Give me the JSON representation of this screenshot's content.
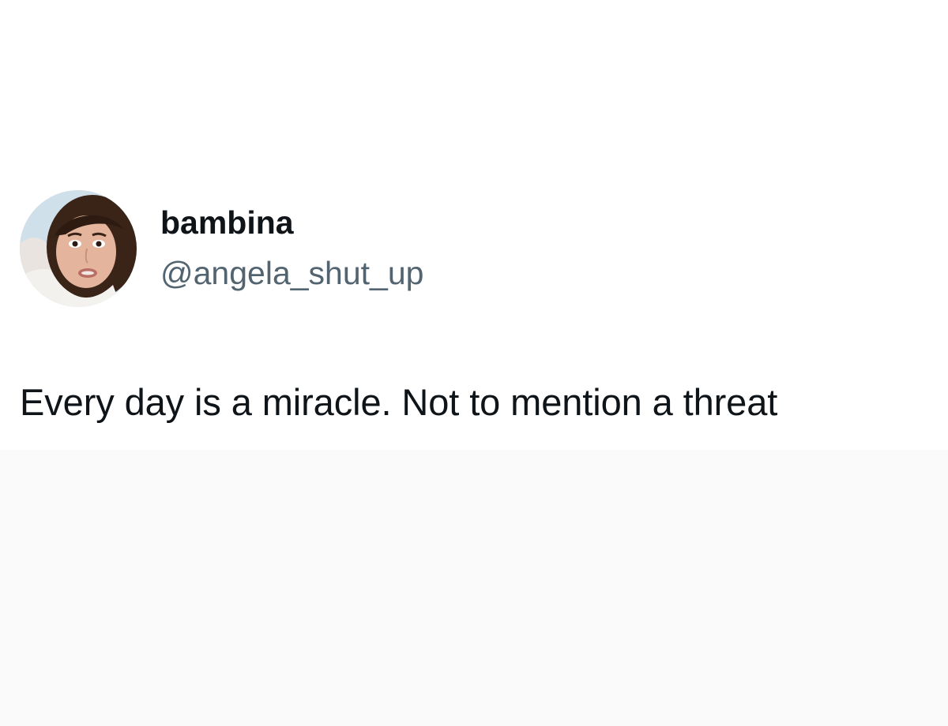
{
  "tweet": {
    "display_name": "bambina",
    "handle": "@angela_shut_up",
    "text": "Every day is a miracle. Not to mention a threat",
    "avatar_icon": "profile-photo"
  },
  "colors": {
    "text_primary": "#0f1419",
    "text_secondary": "#536471",
    "background": "#ffffff",
    "lower_background": "#fafafa"
  }
}
